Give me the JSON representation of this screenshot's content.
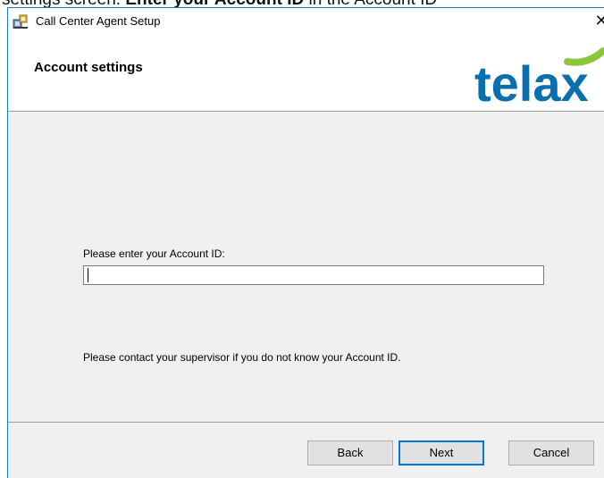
{
  "background_caption": {
    "prefix": "settings screen. ",
    "bold": "Enter your Account ID",
    "suffix": " in the Account ID"
  },
  "window": {
    "title": "Call Center Agent Setup",
    "close_glyph": "✕"
  },
  "header": {
    "title": "Account settings",
    "logo_text": "telax"
  },
  "form": {
    "account_label": "Please enter your Account ID:",
    "account_value": "",
    "help_text": "Please contact your supervisor if you do not know your Account ID."
  },
  "buttons": {
    "back": "Back",
    "next": "Next",
    "cancel": "Cancel"
  },
  "colors": {
    "logo_blue": "#0a6eaf",
    "logo_green": "#8cc63f",
    "accent": "#0078d7",
    "window_border": "#1979ca"
  },
  "icons": {
    "title": "installer-icon",
    "close": "close-icon"
  }
}
